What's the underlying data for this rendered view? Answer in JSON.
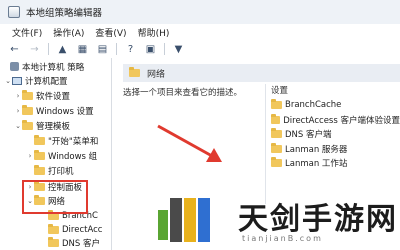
{
  "window": {
    "title": "本地组策略编辑器"
  },
  "menu": [
    "文件(F)",
    "操作(A)",
    "查看(V)",
    "帮助(H)"
  ],
  "toolbar": {
    "buttons": [
      "back-icon",
      "forward-icon",
      "up-folder-icon",
      "show-tree-icon",
      "properties-icon",
      "help-icon",
      "view-icon",
      "filter-icon"
    ]
  },
  "tree": {
    "items": [
      {
        "label": "本地计算机 策略",
        "icon": "computer-policy-icon",
        "indent": 0,
        "arrow": ""
      },
      {
        "label": "计算机配置",
        "icon": "computer-icon",
        "indent": 1,
        "arrow": "v"
      },
      {
        "label": "软件设置",
        "icon": "folder-icon",
        "indent": 2,
        "arrow": ">"
      },
      {
        "label": "Windows 设置",
        "icon": "folder-icon",
        "indent": 2,
        "arrow": ">"
      },
      {
        "label": "管理模板",
        "icon": "folder-icon",
        "indent": 2,
        "arrow": "v"
      },
      {
        "label": "\"开始\"菜单和",
        "icon": "folder-icon",
        "indent": 3,
        "arrow": ""
      },
      {
        "label": "Windows 组",
        "icon": "folder-icon",
        "indent": 3,
        "arrow": ">"
      },
      {
        "label": "打印机",
        "icon": "folder-icon",
        "indent": 3,
        "arrow": ""
      },
      {
        "label": "控制面板",
        "icon": "folder-icon",
        "indent": 3,
        "arrow": ">"
      },
      {
        "label": "网络",
        "icon": "folder-icon",
        "indent": 3,
        "arrow": "v"
      },
      {
        "label": "BranchC",
        "icon": "folder-icon",
        "indent": 4,
        "arrow": ""
      },
      {
        "label": "DirectAcc",
        "icon": "folder-icon",
        "indent": 4,
        "arrow": ""
      },
      {
        "label": "DNS 客户",
        "icon": "folder-icon",
        "indent": 4,
        "arrow": ""
      }
    ]
  },
  "main": {
    "header": "网络",
    "description": "选择一个项目来查看它的描述。",
    "settings_header": "设置",
    "settings": [
      "BranchCache",
      "DirectAccess 客户端体验设置",
      "DNS 客户端",
      "Lanman 服务器",
      "Lanman 工作站"
    ]
  },
  "colors": {
    "highlight": "#e03a2f",
    "folder": "#f1c75c"
  },
  "watermark": {
    "text": "天剑手游网",
    "url": "tianjianB.com"
  }
}
